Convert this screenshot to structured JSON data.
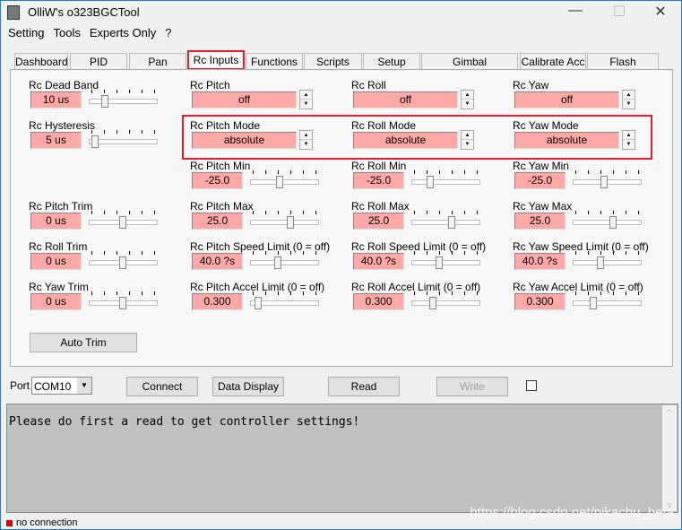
{
  "window": {
    "title": "OlliW's o323BGCTool",
    "minimize": "—",
    "maximize": "☐",
    "close": "✕"
  },
  "menu": [
    "Setting",
    "Tools",
    "Experts Only",
    "?"
  ],
  "tabs": [
    "Dashboard",
    "PID",
    "Pan",
    "Rc Inputs",
    "Functions",
    "Scripts",
    "Setup",
    "Gimbal Configuration",
    "Calibrate Acc",
    "Flash Firmware"
  ],
  "active_tab": "Rc Inputs",
  "fields": [
    {
      "label": "Rc Dead Band",
      "value": "10 us",
      "kind": "slider",
      "level": 0.2
    },
    {
      "label": "Rc Hysteresis",
      "value": "5 us",
      "kind": "slider",
      "level": 0.05
    },
    {
      "label": "Rc Pitch Trim",
      "value": "0 us",
      "kind": "slider",
      "level": 0.5
    },
    {
      "label": "Rc Roll Trim",
      "value": "0 us",
      "kind": "slider",
      "level": 0.5
    },
    {
      "label": "Rc Yaw Trim",
      "value": "0 us",
      "kind": "slider",
      "level": 0.5
    },
    {
      "label": "Rc Pitch",
      "value": "off",
      "kind": "spin"
    },
    {
      "label": "Rc Pitch Mode",
      "value": "absolute",
      "kind": "spin"
    },
    {
      "label": "Rc Pitch Min",
      "value": "-25.0",
      "kind": "slider",
      "level": 0.42
    },
    {
      "label": "Rc Pitch Max",
      "value": "25.0",
      "kind": "slider",
      "level": 0.6
    },
    {
      "label": "Rc Pitch Speed Limit (0 = off)",
      "value": "40.0 ?s",
      "kind": "slider",
      "level": 0.4
    },
    {
      "label": "Rc Pitch Accel Limit (0 = off)",
      "value": "0.300",
      "kind": "slider",
      "level": 0.07
    },
    {
      "label": "Rc Roll",
      "value": "off",
      "kind": "spin"
    },
    {
      "label": "Rc Roll Mode",
      "value": "absolute",
      "kind": "spin"
    },
    {
      "label": "Rc Roll Min",
      "value": "-25.0",
      "kind": "slider",
      "level": 0.25
    },
    {
      "label": "Rc Roll Max",
      "value": "25.0",
      "kind": "slider",
      "level": 0.6
    },
    {
      "label": "Rc Roll Speed Limit (0 = off)",
      "value": "40.0 ?s",
      "kind": "slider",
      "level": 0.4
    },
    {
      "label": "Rc Roll Accel Limit (0 = off)",
      "value": "0.300",
      "kind": "slider",
      "level": 0.3
    },
    {
      "label": "Rc Yaw",
      "value": "off",
      "kind": "spin"
    },
    {
      "label": "Rc Yaw Mode",
      "value": "absolute",
      "kind": "spin"
    },
    {
      "label": "Rc Yaw Min",
      "value": "-25.0",
      "kind": "slider",
      "level": 0.45
    },
    {
      "label": "Rc Yaw Max",
      "value": "25.0",
      "kind": "slider",
      "level": 0.6
    },
    {
      "label": "Rc Yaw Speed Limit (0 = off)",
      "value": "40.0 ?s",
      "kind": "slider",
      "level": 0.4
    },
    {
      "label": "Rc Yaw Accel Limit (0 = off)",
      "value": "0.300",
      "kind": "slider",
      "level": 0.28
    }
  ],
  "auto_trim": "Auto Trim",
  "bottom": {
    "port_label": "Port",
    "port_value": "COM10",
    "connect": "Connect",
    "data_display": "Data Display",
    "read": "Read",
    "write": "Write"
  },
  "console": {
    "text": "Please do first a read to get controller settings!"
  },
  "status": {
    "text": "no connection",
    "color": "#e00000"
  },
  "watermark": "https://blog.csdn.net/pikachu_beta",
  "colors": {
    "field_bg": "#ffa8a8",
    "highlight": "#e0202a"
  }
}
